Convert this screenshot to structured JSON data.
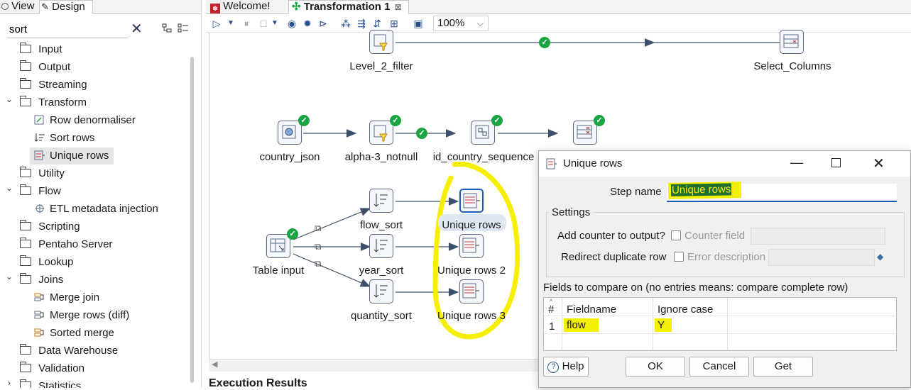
{
  "left_panel": {
    "tabs": {
      "view": "View",
      "design": "Design"
    },
    "search": {
      "value": "sort"
    },
    "tree": [
      {
        "label": "Input",
        "type": "folder",
        "expanded": false
      },
      {
        "label": "Output",
        "type": "folder",
        "expanded": false
      },
      {
        "label": "Streaming",
        "type": "folder",
        "expanded": false
      },
      {
        "label": "Transform",
        "type": "folder",
        "expanded": true
      },
      {
        "label": "Row denormaliser",
        "type": "step"
      },
      {
        "label": "Sort rows",
        "type": "step"
      },
      {
        "label": "Unique rows",
        "type": "step",
        "selected": true
      },
      {
        "label": "Utility",
        "type": "folder",
        "expanded": false
      },
      {
        "label": "Flow",
        "type": "folder",
        "expanded": true
      },
      {
        "label": "ETL metadata injection",
        "type": "step"
      },
      {
        "label": "Scripting",
        "type": "folder",
        "expanded": false
      },
      {
        "label": "Pentaho Server",
        "type": "folder",
        "expanded": false
      },
      {
        "label": "Lookup",
        "type": "folder",
        "expanded": false
      },
      {
        "label": "Joins",
        "type": "folder",
        "expanded": true
      },
      {
        "label": "Merge join",
        "type": "step"
      },
      {
        "label": "Merge rows (diff)",
        "type": "step"
      },
      {
        "label": "Sorted merge",
        "type": "step"
      },
      {
        "label": "Data Warehouse",
        "type": "folder",
        "expanded": false
      },
      {
        "label": "Validation",
        "type": "folder",
        "expanded": false
      },
      {
        "label": "Statistics",
        "type": "folder",
        "expanded": false
      }
    ]
  },
  "editor": {
    "tabs": {
      "welcome": "Welcome!",
      "transformation": "Transformation 1"
    },
    "zoom": "100%",
    "steps": {
      "level2": "Level_2_filter",
      "select_columns": "Select_Columns",
      "country_json": "country_json",
      "alpha3": "alpha-3_notnull",
      "id_country": "id_country_sequence",
      "table_input": "Table input",
      "flow_sort": "flow_sort",
      "year_sort": "year_sort",
      "quantity_sort": "quantity_sort",
      "unique1": "Unique rows",
      "unique2": "Unique rows 2",
      "unique3": "Unique rows 3"
    },
    "execution_results": "Execution Results"
  },
  "dialog": {
    "title": "Unique rows",
    "step_name_label": "Step name",
    "step_name_value": "Unique rows",
    "settings_label": "Settings",
    "add_counter_label": "Add counter to output?",
    "counter_field_label": "Counter field",
    "redirect_label": "Redirect duplicate row",
    "error_desc_label": "Error description",
    "fields_label": "Fields to compare on (no entries means: compare complete row)",
    "table": {
      "headers": [
        "#",
        "Fieldname",
        "Ignore case"
      ],
      "rows": [
        {
          "num": "1",
          "fieldname": "flow",
          "ignore_case": "Y"
        }
      ]
    },
    "buttons": {
      "help": "Help",
      "ok": "OK",
      "cancel": "Cancel",
      "get": "Get"
    }
  },
  "colors": {
    "highlight_yellow": "#ffff00",
    "accent_blue": "#1d5bb8",
    "check_green": "#1aa542"
  }
}
